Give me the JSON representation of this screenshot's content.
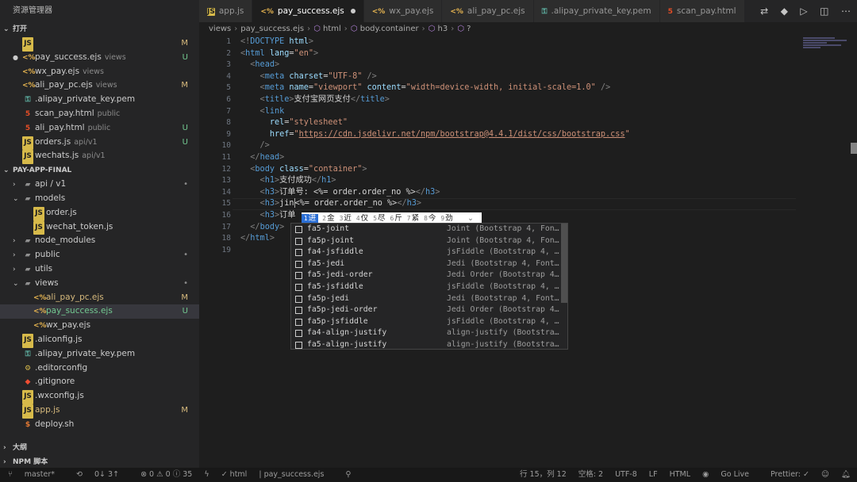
{
  "explorer": {
    "title": "资源管理器",
    "open_editors_label": "打开",
    "open_editors": [
      {
        "name": "",
        "icon": "js",
        "status": "M",
        "dim": ""
      },
      {
        "name": "pay_success.ejs",
        "icon": "ejs",
        "dim": "views",
        "status": "U",
        "dot": true
      },
      {
        "name": "wx_pay.ejs",
        "icon": "ejs",
        "dim": "views",
        "status": ""
      },
      {
        "name": "ali_pay_pc.ejs",
        "icon": "ejs",
        "dim": "views",
        "status": "M"
      },
      {
        "name": ".alipay_private_key.pem",
        "icon": "key",
        "dim": "",
        "status": ""
      },
      {
        "name": "scan_pay.html",
        "icon": "html",
        "dim": "public",
        "status": ""
      },
      {
        "name": "ali_pay.html",
        "icon": "html",
        "dim": "public",
        "status": "U"
      },
      {
        "name": "orders.js",
        "icon": "js",
        "dim": "api/v1",
        "status": "U"
      },
      {
        "name": "wechats.js",
        "icon": "js",
        "dim": "api/v1",
        "status": ""
      }
    ],
    "project_label": "PAY-APP-FINAL",
    "tree": [
      {
        "name": "api / v1",
        "icon": "folder",
        "indent": 1,
        "twisty": "›",
        "status": "•"
      },
      {
        "name": "models",
        "icon": "folder",
        "indent": 1,
        "twisty": "⌄",
        "status": ""
      },
      {
        "name": "order.js",
        "icon": "js",
        "indent": 2,
        "twisty": "",
        "status": ""
      },
      {
        "name": "wechat_token.js",
        "icon": "js",
        "indent": 2,
        "twisty": "",
        "status": ""
      },
      {
        "name": "node_modules",
        "icon": "folder",
        "indent": 1,
        "twisty": "›",
        "status": ""
      },
      {
        "name": "public",
        "icon": "folder",
        "indent": 1,
        "twisty": "›",
        "status": "•"
      },
      {
        "name": "utils",
        "icon": "folder",
        "indent": 1,
        "twisty": "›",
        "status": ""
      },
      {
        "name": "views",
        "icon": "folder",
        "indent": 1,
        "twisty": "⌄",
        "status": "•"
      },
      {
        "name": "ali_pay_pc.ejs",
        "icon": "ejs",
        "indent": 2,
        "twisty": "",
        "status": "M"
      },
      {
        "name": "pay_success.ejs",
        "icon": "ejs",
        "indent": 2,
        "twisty": "",
        "status": "U",
        "selected": true
      },
      {
        "name": "wx_pay.ejs",
        "icon": "ejs",
        "indent": 2,
        "twisty": "",
        "status": ""
      },
      {
        "name": ".aliconfig.js",
        "icon": "js",
        "indent": 1,
        "twisty": "",
        "status": ""
      },
      {
        "name": ".alipay_private_key.pem",
        "icon": "key",
        "indent": 1,
        "twisty": "",
        "status": ""
      },
      {
        "name": ".editorconfig",
        "icon": "cfg",
        "indent": 1,
        "twisty": "",
        "status": ""
      },
      {
        "name": ".gitignore",
        "icon": "git",
        "indent": 1,
        "twisty": "",
        "status": ""
      },
      {
        "name": ".wxconfig.js",
        "icon": "js",
        "indent": 1,
        "twisty": "",
        "status": ""
      },
      {
        "name": "app.js",
        "icon": "js",
        "indent": 1,
        "twisty": "",
        "status": "M"
      },
      {
        "name": "deploy.sh",
        "icon": "sh",
        "indent": 1,
        "twisty": "",
        "status": ""
      }
    ],
    "outline_label": "大纲",
    "npm_label": "NPM 脚本"
  },
  "tabs": [
    {
      "label": "app.js",
      "icon": "js",
      "active": false
    },
    {
      "label": "pay_success.ejs",
      "icon": "ejs",
      "active": true,
      "dirty": true
    },
    {
      "label": "wx_pay.ejs",
      "icon": "ejs",
      "active": false
    },
    {
      "label": "ali_pay_pc.ejs",
      "icon": "ejs",
      "active": false
    },
    {
      "label": ".alipay_private_key.pem",
      "icon": "key",
      "active": false
    },
    {
      "label": "scan_pay.html",
      "icon": "html",
      "active": false
    }
  ],
  "breadcrumb": [
    "views",
    "pay_success.ejs",
    "html",
    "body.container",
    "h3",
    "?"
  ],
  "code_lines": [
    [
      [
        "p",
        "<!"
      ],
      [
        "t",
        "DOCTYPE"
      ],
      [
        "a",
        " html"
      ],
      [
        "p",
        ">"
      ]
    ],
    [
      [
        "p",
        "<"
      ],
      [
        "t",
        "html"
      ],
      [
        "a",
        " lang"
      ],
      [
        "w",
        "="
      ],
      [
        "s",
        "\"en\""
      ],
      [
        "p",
        ">"
      ]
    ],
    [
      [
        "w",
        "  "
      ],
      [
        "p",
        "<"
      ],
      [
        "t",
        "head"
      ],
      [
        "p",
        ">"
      ]
    ],
    [
      [
        "w",
        "    "
      ],
      [
        "p",
        "<"
      ],
      [
        "t",
        "meta"
      ],
      [
        "a",
        " charset"
      ],
      [
        "w",
        "="
      ],
      [
        "s",
        "\"UTF-8\""
      ],
      [
        "p",
        " />"
      ]
    ],
    [
      [
        "w",
        "    "
      ],
      [
        "p",
        "<"
      ],
      [
        "t",
        "meta"
      ],
      [
        "a",
        " name"
      ],
      [
        "w",
        "="
      ],
      [
        "s",
        "\"viewport\""
      ],
      [
        "a",
        " content"
      ],
      [
        "w",
        "="
      ],
      [
        "s",
        "\"width=device-width, initial-scale=1.0\""
      ],
      [
        "p",
        " />"
      ]
    ],
    [
      [
        "w",
        "    "
      ],
      [
        "p",
        "<"
      ],
      [
        "t",
        "title"
      ],
      [
        "p",
        ">"
      ],
      [
        "w",
        "支付宝网页支付"
      ],
      [
        "p",
        "</"
      ],
      [
        "t",
        "title"
      ],
      [
        "p",
        ">"
      ]
    ],
    [
      [
        "w",
        "    "
      ],
      [
        "p",
        "<"
      ],
      [
        "t",
        "link"
      ]
    ],
    [
      [
        "w",
        "      "
      ],
      [
        "a",
        "rel"
      ],
      [
        "w",
        "="
      ],
      [
        "s",
        "\"stylesheet\""
      ]
    ],
    [
      [
        "w",
        "      "
      ],
      [
        "a",
        "href"
      ],
      [
        "w",
        "="
      ],
      [
        "s",
        "\""
      ],
      [
        "u",
        "https://cdn.jsdelivr.net/npm/bootstrap@4.4.1/dist/css/bootstrap.css"
      ],
      [
        "s",
        "\""
      ]
    ],
    [
      [
        "w",
        "    "
      ],
      [
        "p",
        "/>"
      ]
    ],
    [
      [
        "w",
        "  "
      ],
      [
        "p",
        "</"
      ],
      [
        "t",
        "head"
      ],
      [
        "p",
        ">"
      ]
    ],
    [
      [
        "w",
        "  "
      ],
      [
        "p",
        "<"
      ],
      [
        "t",
        "body"
      ],
      [
        "a",
        " class"
      ],
      [
        "w",
        "="
      ],
      [
        "s",
        "\"container\""
      ],
      [
        "p",
        ">"
      ]
    ],
    [
      [
        "w",
        "    "
      ],
      [
        "p",
        "<"
      ],
      [
        "t",
        "h1"
      ],
      [
        "p",
        ">"
      ],
      [
        "w",
        "支付成功"
      ],
      [
        "p",
        "</"
      ],
      [
        "t",
        "h1"
      ],
      [
        "p",
        ">"
      ]
    ],
    [
      [
        "w",
        "    "
      ],
      [
        "p",
        "<"
      ],
      [
        "t",
        "h3"
      ],
      [
        "p",
        ">"
      ],
      [
        "w",
        "订单号: <%= order.order_no %>"
      ],
      [
        "p",
        "</"
      ],
      [
        "t",
        "h3"
      ],
      [
        "p",
        ">"
      ]
    ],
    [
      [
        "w",
        "    "
      ],
      [
        "p",
        "<"
      ],
      [
        "t",
        "h3"
      ],
      [
        "p",
        ">"
      ],
      [
        "w",
        "jin"
      ],
      [
        "c",
        ""
      ],
      [
        "w",
        "<%= order.order_no %>"
      ],
      [
        "p",
        "</"
      ],
      [
        "t",
        "h3"
      ],
      [
        "p",
        ">"
      ]
    ],
    [
      [
        "w",
        "    "
      ],
      [
        "p",
        "<"
      ],
      [
        "t",
        "h3"
      ],
      [
        "p",
        ">"
      ],
      [
        "w",
        "订单"
      ]
    ],
    [
      [
        "w",
        "  "
      ],
      [
        "p",
        "</"
      ],
      [
        "t",
        "body"
      ],
      [
        "p",
        ">"
      ]
    ],
    [
      [
        "p",
        "</"
      ],
      [
        "t",
        "html"
      ],
      [
        "p",
        ">"
      ]
    ],
    []
  ],
  "ime": {
    "candidates": [
      {
        "n": "1",
        "c": "进"
      },
      {
        "n": "2",
        "c": "金"
      },
      {
        "n": "3",
        "c": "近"
      },
      {
        "n": "4",
        "c": "仅"
      },
      {
        "n": "5",
        "c": "尽"
      },
      {
        "n": "6",
        "c": "斤"
      },
      {
        "n": "7",
        "c": "紧"
      },
      {
        "n": "8",
        "c": "今"
      },
      {
        "n": "9",
        "c": "劲"
      }
    ],
    "more": "⌄"
  },
  "suggestions": [
    {
      "label": "fa5-joint",
      "hl": "j",
      "detail": "Joint (Bootstrap 4, Fon…"
    },
    {
      "label": "fa5p-joint",
      "hl": "j",
      "detail": "Joint (Bootstrap 4, Fon…"
    },
    {
      "label": "fa4-jsfiddle",
      "hl": "j",
      "detail": "jsFiddle (Bootstrap 4, …"
    },
    {
      "label": "fa5-jedi",
      "hl": "j",
      "detail": "Jedi (Bootstrap 4, Font…"
    },
    {
      "label": "fa5-jedi-order",
      "hl": "j",
      "detail": "Jedi Order (Bootstrap 4…"
    },
    {
      "label": "fa5-jsfiddle",
      "hl": "j",
      "detail": "jsFiddle (Bootstrap 4, …"
    },
    {
      "label": "fa5p-jedi",
      "hl": "j",
      "detail": "Jedi (Bootstrap 4, Font…"
    },
    {
      "label": "fa5p-jedi-order",
      "hl": "j",
      "detail": "Jedi Order (Bootstrap 4…"
    },
    {
      "label": "fa5p-jsfiddle",
      "hl": "j",
      "detail": "jsFiddle (Bootstrap 4, …"
    },
    {
      "label": "fa4-align-justify",
      "hl": "j",
      "detail": "align-justify (Bootstra…"
    },
    {
      "label": "fa5-align-justify",
      "hl": "j",
      "detail": "align-justify (Bootstra…"
    }
  ],
  "status": {
    "branch": "master*",
    "sync": "0↓ 3↑",
    "problems": "⊗ 0 ⚠ 0 ⓘ 35",
    "lang_crumb": "html",
    "file_crumb": "pay_success.ejs",
    "position": "行 15，列 12",
    "spaces": "空格: 2",
    "encoding": "UTF-8",
    "eol": "LF",
    "language": "HTML",
    "golive": "Go Live",
    "prettier": "Prettier: ✓"
  }
}
